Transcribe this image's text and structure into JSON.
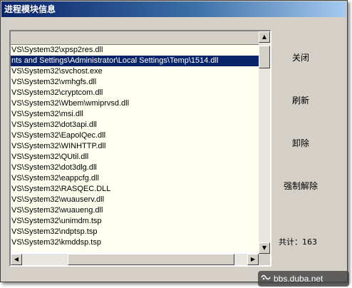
{
  "window": {
    "title": "进程模块信息"
  },
  "module_list": {
    "rows": [
      "VS\\System32\\xpsp2res.dll",
      "nts and Settings\\Administrator\\Local Settings\\Temp\\1514.dll",
      "VS\\System32\\svchost.exe",
      "VS\\System32\\vmhgfs.dll",
      "VS\\System32\\cryptcom.dll",
      "VS\\System32\\Wbem\\wmiprvsd.dll",
      "VS\\System32\\msi.dll",
      "VS\\System32\\dot3api.dll",
      "VS\\System32\\EapolQec.dll",
      "VS\\System32\\WINHTTP.dll",
      "VS\\System32\\QUtil.dll",
      "VS\\System32\\dot3dlg.dll",
      "VS\\System32\\eappcfg.dll",
      "VS\\System32\\RASQEC.DLL",
      "VS\\System32\\wuauserv.dll",
      "VS\\System32\\wuaueng.dll",
      "VS\\System32\\unimdm.tsp",
      "VS\\System32\\ndptsp.tsp",
      "VS\\System32\\kmddsp.tsp"
    ],
    "selected_index": 1
  },
  "buttons": {
    "close": "关闭",
    "refresh": "刷新",
    "unload": "卸除",
    "force_unload": "强制解除"
  },
  "count_label": "共计：163",
  "watermark": {
    "text": "bbs.duba.net",
    "icon": "duba-logo-icon"
  }
}
